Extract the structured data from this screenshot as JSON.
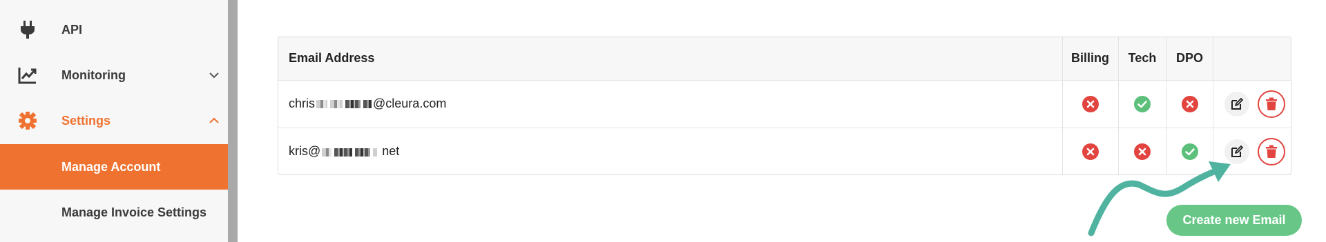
{
  "sidebar": {
    "items": [
      {
        "label": "API",
        "icon": "plug-icon"
      },
      {
        "label": "Monitoring",
        "icon": "chart-icon"
      },
      {
        "label": "Settings",
        "icon": "gear-icon"
      }
    ],
    "sub_items": [
      {
        "label": "Manage Account",
        "active": true
      },
      {
        "label": "Manage Invoice Settings",
        "active": false
      }
    ]
  },
  "table": {
    "headers": [
      "Email Address",
      "Billing",
      "Tech",
      "DPO",
      ""
    ],
    "rows": [
      {
        "email_prefix": "chris",
        "email_suffix": "@cleura.com",
        "billing": false,
        "tech": true,
        "dpo": false
      },
      {
        "email_prefix": "kris@",
        "email_suffix": " net",
        "billing": false,
        "tech": false,
        "dpo": true
      }
    ]
  },
  "actions": {
    "create_label": "Create new Email"
  },
  "colors": {
    "accent": "#ef7230",
    "success": "#5cc07a",
    "danger": "#e2443f",
    "arrow": "#4fb3a0"
  }
}
